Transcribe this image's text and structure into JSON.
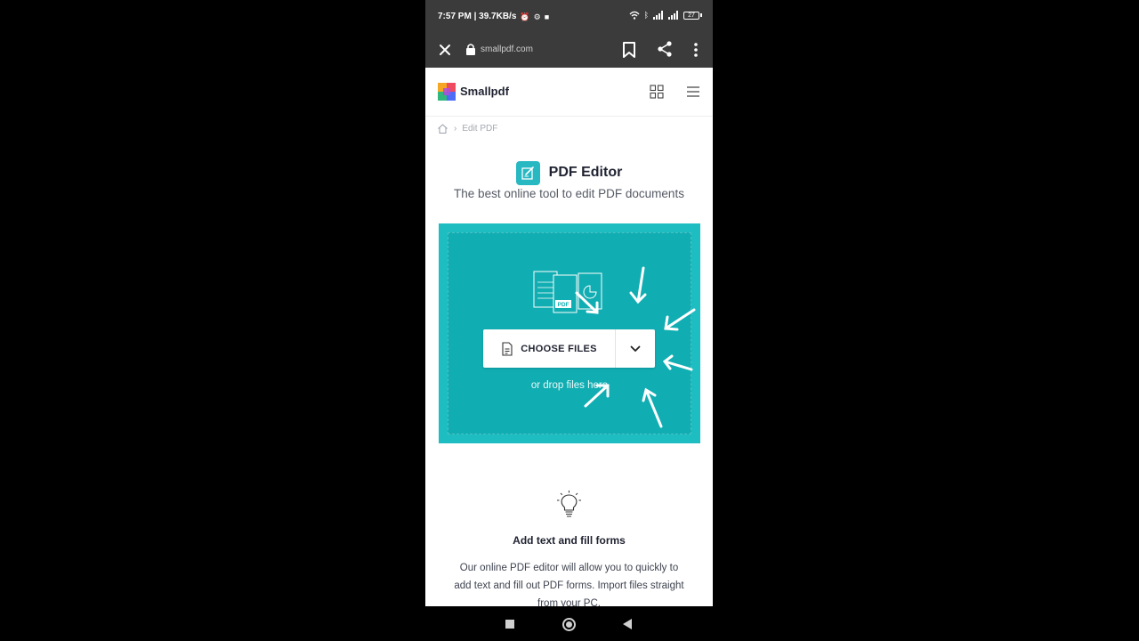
{
  "status_bar": {
    "time_info": "7:57 PM | 39.7KB/s",
    "battery": "27"
  },
  "browser": {
    "url": "smallpdf.com"
  },
  "site": {
    "logo_text": "Smallpdf"
  },
  "breadcrumb": {
    "current": "Edit PDF"
  },
  "tool": {
    "title": "PDF Editor",
    "subtitle": "The best online tool to edit PDF documents"
  },
  "drop_zone": {
    "choose_files_label": "CHOOSE FILES",
    "drop_hint": "or drop files here",
    "illustration_label": "PDF",
    "colors": {
      "outer": "#1dbdc1",
      "inner": "#10adb2"
    }
  },
  "feature": {
    "title": "Add text and fill forms",
    "description": "Our online PDF editor will allow you to quickly to add text and fill out PDF forms. Import files straight from your PC."
  },
  "icons": {
    "status": [
      "alarm-icon",
      "settings-icon",
      "video-icon",
      "wifi-icon",
      "bluetooth-icon",
      "signal-icon",
      "battery-icon"
    ],
    "browser": [
      "close-icon",
      "lock-icon",
      "bookmark-icon",
      "share-icon",
      "more-icon"
    ],
    "site": [
      "smallpdf-logo-icon",
      "apps-grid-icon",
      "hamburger-menu-icon",
      "home-icon",
      "pdf-editor-icon",
      "file-icon",
      "chevron-down-icon",
      "lightbulb-icon"
    ]
  },
  "colors": {
    "accent": "#27b8c2",
    "status_bar": "#3b3b3b",
    "text_dark": "#1f2230"
  }
}
